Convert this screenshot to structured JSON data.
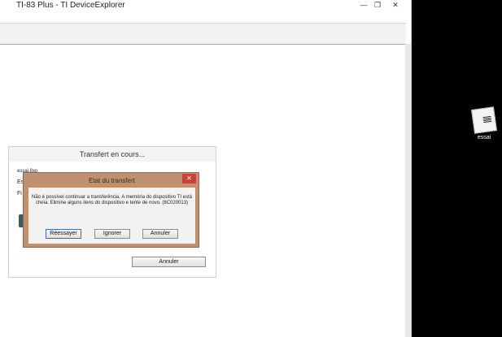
{
  "window": {
    "title": "TI-83 Plus - TI DeviceExplorer",
    "controls": {
      "minimize": "—",
      "maximize": "❐",
      "close": "✕"
    }
  },
  "progress_dialog": {
    "title": "Transfert en cours...",
    "file_line": "essai.8xp",
    "label_fragment_1": "Es",
    "label_fragment_2": "Fi",
    "cancel_label": "Annuler"
  },
  "error_dialog": {
    "title": "Etat du transfert",
    "close_label": "✕",
    "message": "Não é possível continuar a transferência. A memória do dispositivo TI está cheia. Elimine alguns itens do dispositivo e tente de novo. (8C020013)",
    "retry_label": "Réessayer",
    "ignore_label": "Ignorer",
    "cancel_label": "Annuler"
  },
  "desktop": {
    "icon_label": "essai"
  }
}
